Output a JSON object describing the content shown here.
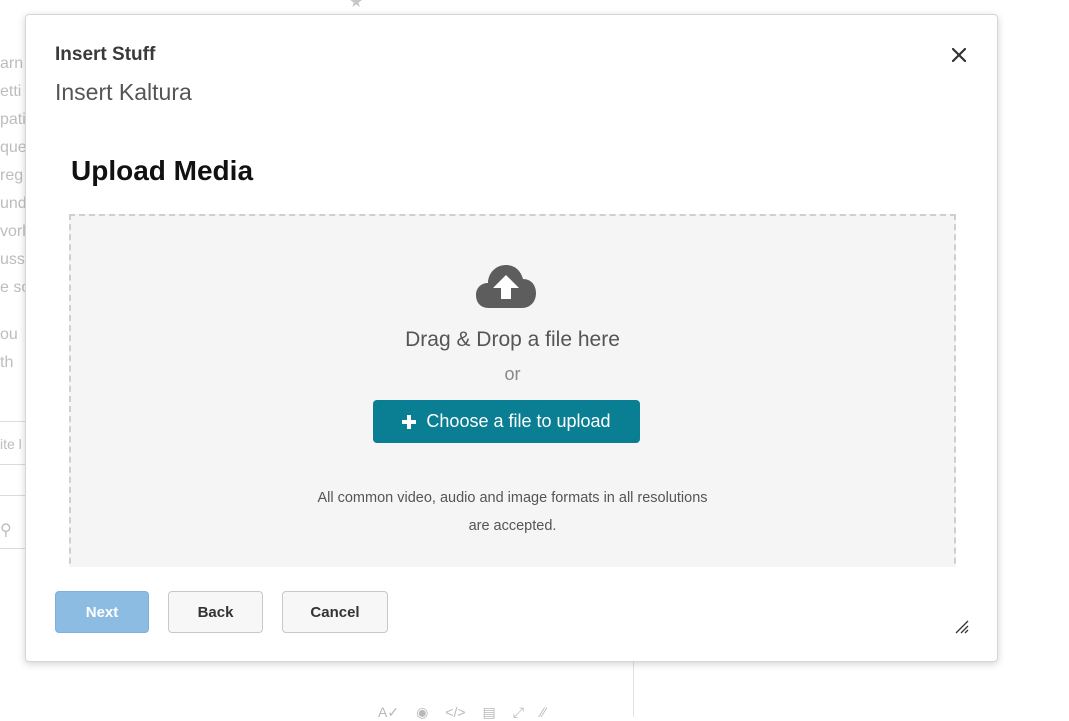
{
  "background": {
    "lines": [
      "arn",
      "etti",
      "pati",
      "que",
      "reg",
      "und",
      "vorl",
      "uss",
      "e so",
      "ou",
      "th",
      "ite l"
    ]
  },
  "modal": {
    "title": "Insert Stuff",
    "subtitle": "Insert Kaltura",
    "close_icon": "close-icon"
  },
  "upload": {
    "heading": "Upload Media",
    "drop_text": "Drag & Drop a file here",
    "or_text": "or",
    "choose_button_label": "Choose a file to upload",
    "formats_line1": "All common video, audio and image formats in all resolutions",
    "formats_line2": "are accepted.",
    "icon": "cloud-upload-icon"
  },
  "footer": {
    "next_label": "Next",
    "back_label": "Back",
    "cancel_label": "Cancel"
  },
  "colors": {
    "primary": "#0a7f93",
    "next_disabled": "#8dbce3",
    "dropzone_bg": "#f5f5f5"
  }
}
